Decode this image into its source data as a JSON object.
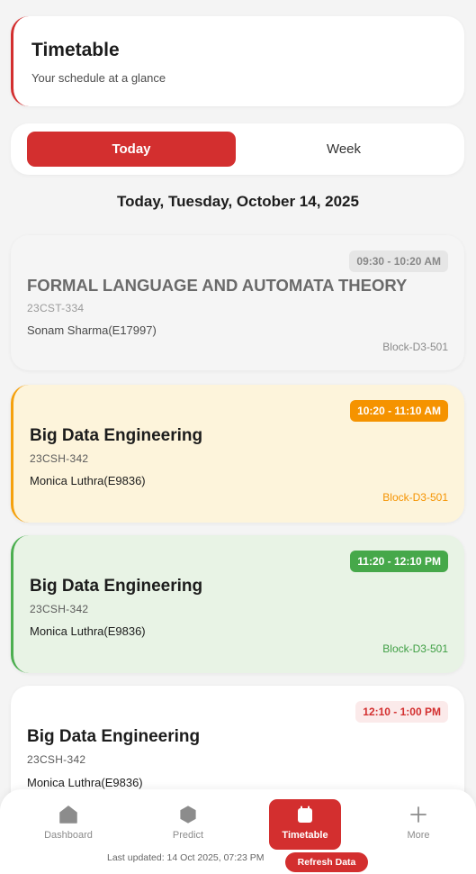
{
  "header": {
    "title": "Timetable",
    "subtitle": "Your schedule at a glance"
  },
  "segment": {
    "today_label": "Today",
    "week_label": "Week",
    "selected": "Today"
  },
  "date_heading": "Today, Tuesday, October 14, 2025",
  "classes": [
    {
      "time": "09:30 - 10:20 AM",
      "subject": "FORMAL LANGUAGE AND AUTOMATA THEORY",
      "code": "23CST-334",
      "teacher": "Sonam Sharma(E17997)",
      "room": "Block-D3-501",
      "status": "past"
    },
    {
      "time": "10:20 - 11:10 AM",
      "subject": "Big Data Engineering",
      "code": "23CSH-342",
      "teacher": "Monica Luthra(E9836)",
      "room": "Block-D3-501",
      "status": "current"
    },
    {
      "time": "11:20 - 12:10 PM",
      "subject": "Big Data Engineering",
      "code": "23CSH-342",
      "teacher": "Monica Luthra(E9836)",
      "room": "Block-D3-501",
      "status": "next"
    },
    {
      "time": "12:10 - 1:00 PM",
      "subject": "Big Data Engineering",
      "code": "23CSH-342",
      "teacher": "Monica Luthra(E9836)",
      "status": "upcoming"
    }
  ],
  "colors": {
    "accent": "#d32f2f",
    "current": "#f59300",
    "next": "#4caf50",
    "past": "#888888"
  },
  "nav": {
    "items": [
      {
        "label": "Dashboard",
        "icon": "home-icon"
      },
      {
        "label": "Predict",
        "icon": "hexagon-icon"
      },
      {
        "label": "Timetable",
        "icon": "calendar-icon",
        "active": true
      },
      {
        "label": "More",
        "icon": "plus-icon"
      }
    ],
    "last_updated": "Last updated: 14 Oct 2025, 07:23 PM",
    "refresh_label": "Refresh Data"
  }
}
